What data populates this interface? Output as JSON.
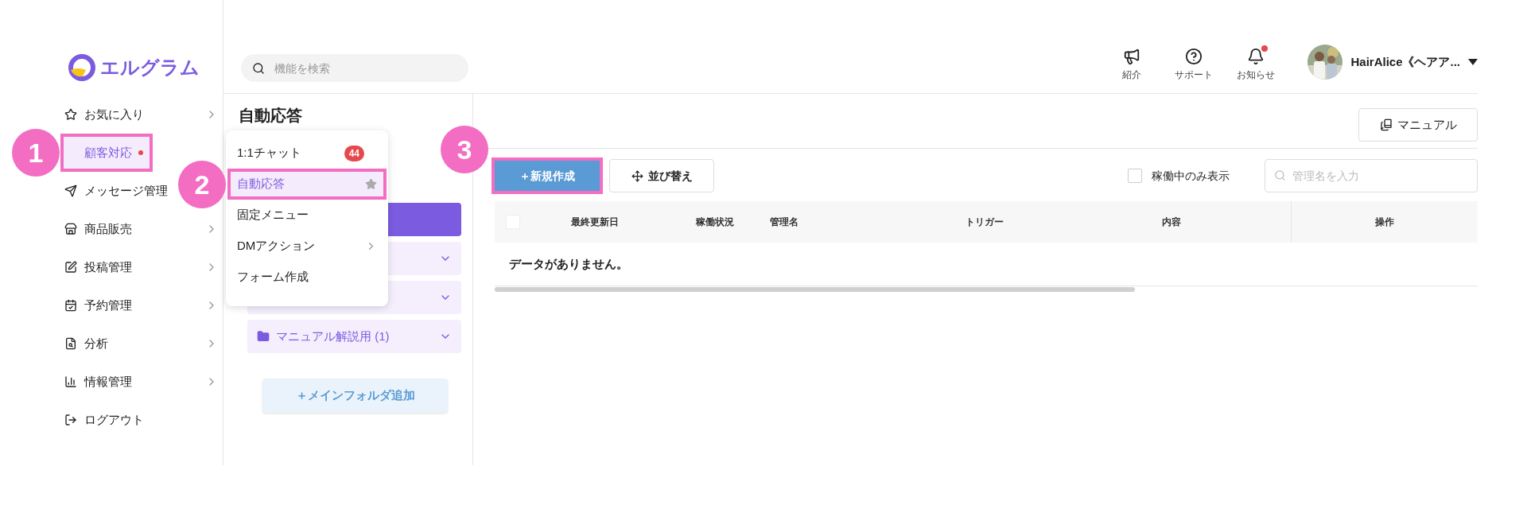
{
  "logo": {
    "text": "エルグラム"
  },
  "search": {
    "placeholder": "機能を検索"
  },
  "header_icons": [
    {
      "label": "紹介",
      "kind": "megaphone",
      "badge": false
    },
    {
      "label": "サポート",
      "kind": "help",
      "badge": false
    },
    {
      "label": "お知らせ",
      "kind": "bell",
      "badge": true
    }
  ],
  "user": {
    "name": "HairAlice《ヘアア..."
  },
  "sidebar": {
    "items": [
      {
        "label": "お気に入り",
        "selected": false,
        "dot": false,
        "highlighted": false,
        "chevron": true
      },
      {
        "label": "顧客対応",
        "selected": true,
        "dot": true,
        "highlighted": true,
        "chevron": false
      },
      {
        "label": "メッセージ管理",
        "selected": false,
        "dot": false,
        "highlighted": false,
        "chevron": false
      },
      {
        "label": "商品販売",
        "selected": false,
        "dot": false,
        "highlighted": false,
        "chevron": true
      },
      {
        "label": "投稿管理",
        "selected": false,
        "dot": false,
        "highlighted": false,
        "chevron": true
      },
      {
        "label": "予約管理",
        "selected": false,
        "dot": false,
        "highlighted": false,
        "chevron": true
      },
      {
        "label": "分析",
        "selected": false,
        "dot": false,
        "highlighted": false,
        "chevron": true
      },
      {
        "label": "情報管理",
        "selected": false,
        "dot": false,
        "highlighted": false,
        "chevron": true
      },
      {
        "label": "ログアウト",
        "selected": false,
        "dot": false,
        "highlighted": false,
        "chevron": false
      }
    ]
  },
  "submenu": {
    "items": [
      {
        "label": "1:1チャット",
        "badge": "44",
        "selected": false,
        "highlighted": false,
        "star": false,
        "has_submenu": false
      },
      {
        "label": "自動応答",
        "selected": true,
        "highlighted": true,
        "star": true,
        "has_submenu": false
      },
      {
        "label": "固定メニュー",
        "selected": false,
        "highlighted": false,
        "star": false,
        "has_submenu": false
      },
      {
        "label": "DMアクション",
        "selected": false,
        "highlighted": false,
        "star": false,
        "has_submenu": true
      },
      {
        "label": "フォーム作成",
        "selected": false,
        "highlighted": false,
        "star": false,
        "has_submenu": false
      }
    ]
  },
  "folder_panel": {
    "title": "自動応答",
    "folders": [
      {
        "selected": true
      },
      {
        "selected": false
      },
      {
        "selected": false
      },
      {
        "selected": false,
        "label": "マニュアル解説用 (1)"
      }
    ],
    "add_button": "＋メインフォルダ追加"
  },
  "main": {
    "manual_button": "マニュアル",
    "create_button": {
      "label": "＋新規作成",
      "highlighted": true
    },
    "sort_button": "並び替え",
    "filter": {
      "label": "稼働中のみ表示",
      "checked": false
    },
    "search": {
      "placeholder": "管理名を入力"
    },
    "table": {
      "header_checkbox": {
        "checked": false
      },
      "columns": [
        "最終更新日",
        "稼働状況",
        "管理名",
        "トリガー",
        "内容",
        "操作"
      ],
      "empty_text": "データがありません。"
    }
  },
  "annotations": [
    {
      "label": "1"
    },
    {
      "label": "2"
    },
    {
      "label": "3"
    }
  ]
}
